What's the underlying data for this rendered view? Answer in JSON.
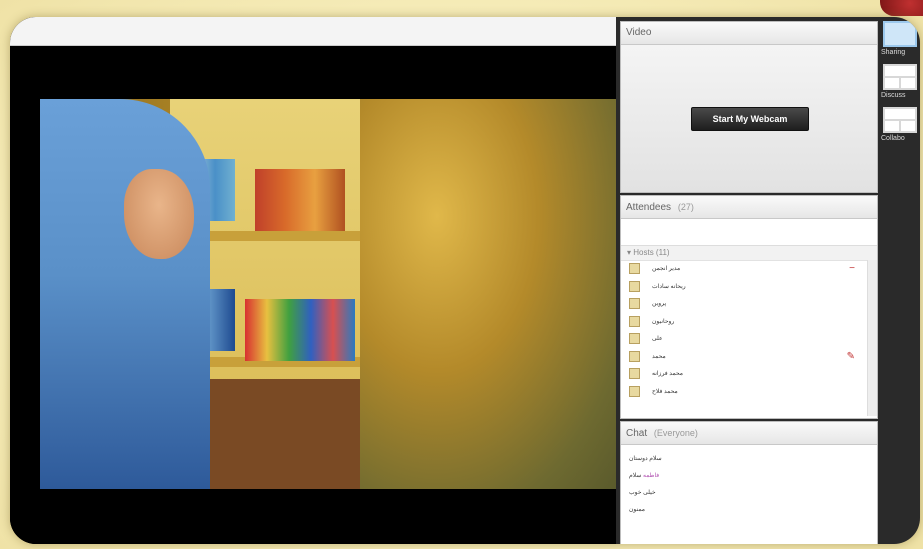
{
  "video_panel": {
    "title": "Video",
    "webcam_button": "Start My Webcam"
  },
  "attendees": {
    "title": "Attendees",
    "count": "(27)",
    "hosts_label": "Hosts (11)",
    "list": [
      {
        "name": "مدیر انجمن"
      },
      {
        "name": "ریحانه سادات"
      },
      {
        "name": "پروین"
      },
      {
        "name": "روحانیون"
      },
      {
        "name": "علی"
      },
      {
        "name": "محمد"
      },
      {
        "name": "محمد فرزانه"
      },
      {
        "name": "محمد فلاح"
      }
    ]
  },
  "chat": {
    "title": "Chat",
    "sub": "(Everyone)",
    "messages": [
      {
        "who": "",
        "text": "سلام دوستان"
      },
      {
        "who": "فاطمه",
        "text": "سلام"
      },
      {
        "who": "",
        "text": "خیلی خوب"
      },
      {
        "who": "",
        "text": "ممنون"
      }
    ]
  },
  "sidebar": {
    "items": [
      "Sharing",
      "Discuss",
      "Collabo"
    ]
  }
}
